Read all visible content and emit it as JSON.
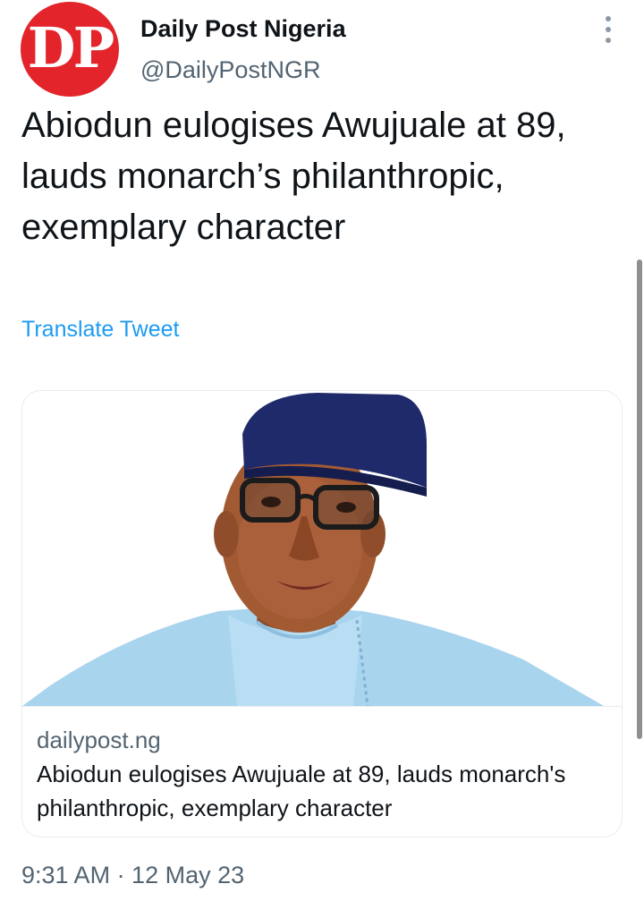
{
  "author": {
    "avatar_initials": "DP",
    "name": "Daily Post Nigeria",
    "handle": "@DailyPostNGR"
  },
  "tweet": {
    "text": "Abiodun eulogises Awujuale at 89, lauds monarch’s philanthropic, exemplary character",
    "translate_label": "Translate Tweet",
    "timestamp": "9:31 AM · 12 May 23"
  },
  "card": {
    "domain": "dailypost.ng",
    "title": "Abiodun eulogises Awujuale at 89, lauds monarch's philanthropic, exemplary character"
  },
  "icons": {
    "more": "more-vertical-icon"
  },
  "colors": {
    "brand_red": "#e3242b",
    "link_blue": "#1d9bf0",
    "secondary_text": "#536471",
    "cap_navy": "#1f2a6b",
    "agbada_blue": "#a9d4ee"
  }
}
